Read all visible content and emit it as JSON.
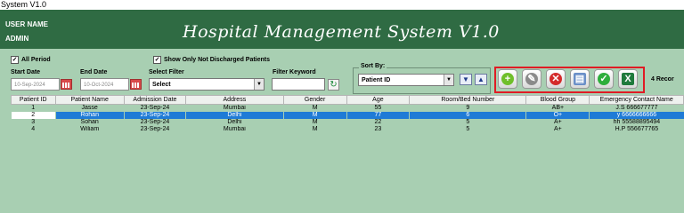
{
  "window": {
    "title": "System V1.0"
  },
  "header": {
    "user_label": "USER NAME",
    "user_value": "ADMIN",
    "app_title": "Hospital Management System V1.0"
  },
  "filters": {
    "all_period": {
      "label": "All Period",
      "checked": true
    },
    "not_discharged": {
      "label": "Show Only Not Discharged Patients",
      "checked": true
    },
    "start_date": {
      "label": "Start Date",
      "value": "10-Sep-2024"
    },
    "end_date": {
      "label": "End Date",
      "value": "10-Oct-2024"
    },
    "select_filter": {
      "label": "Select Filter",
      "value": "Select"
    },
    "filter_keyword": {
      "label": "Filter Keyword",
      "value": ""
    },
    "sort_by": {
      "label": "Sort By:",
      "value": "Patient ID"
    }
  },
  "toolbar": {
    "icons": [
      "add-icon",
      "edit-icon",
      "delete-icon",
      "print-icon",
      "check-icon",
      "excel-icon"
    ],
    "highlight_color": "#e01b24"
  },
  "records_label": "4 Recor",
  "table": {
    "columns": [
      "Patient ID",
      "Patient Name",
      "Admission Date",
      "Address",
      "Gender",
      "Age",
      "Room/Bed Number",
      "Blood Group",
      "Emergency Contact Name"
    ],
    "rows": [
      [
        "1",
        "Jasse",
        "23-Sep-24",
        "Mumbai",
        "M",
        "55",
        "9",
        "AB+",
        "J.S 666677777"
      ],
      [
        "2",
        "Rohan",
        "23-Sep-24",
        "Delhi",
        "M",
        "77",
        "6",
        "O+",
        "y 6666666666"
      ],
      [
        "3",
        "Sohan",
        "23-Sep-24",
        "Delhi",
        "M",
        "22",
        "5",
        "A+",
        "hh 55588895494"
      ],
      [
        "4",
        "Wiliam",
        "23-Sep-24",
        "Mumbai",
        "M",
        "23",
        "5",
        "A+",
        "H.P 556677765"
      ]
    ],
    "selected_row": 1
  },
  "colors": {
    "header_bg": "#2f6b43",
    "body_bg": "#a8cfb2",
    "selection": "#1f7bd6"
  }
}
